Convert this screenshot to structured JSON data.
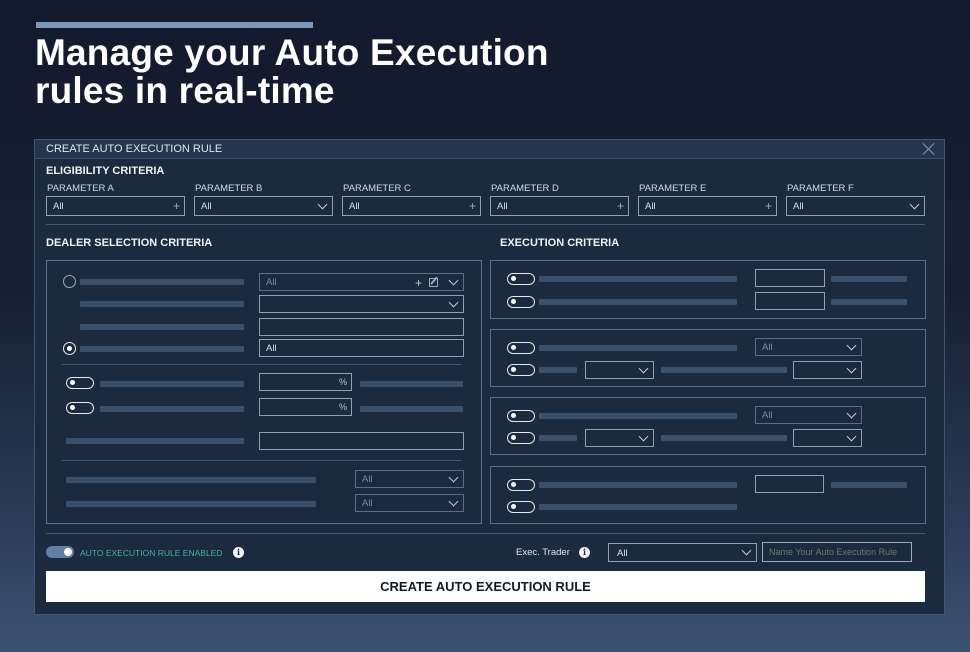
{
  "headline": {
    "line1": "Manage your Auto Execution",
    "line2": "rules in real-time"
  },
  "dialog": {
    "title": "CREATE AUTO EXECUTION RULE",
    "eligibility": {
      "title": "ELIGIBILITY CRITERIA",
      "params": [
        {
          "label": "PARAMETER A",
          "value": "All",
          "control": "plus"
        },
        {
          "label": "PARAMETER B",
          "value": "All",
          "control": "dropdown"
        },
        {
          "label": "PARAMETER C",
          "value": "All",
          "control": "plus"
        },
        {
          "label": "PARAMETER D",
          "value": "All",
          "control": "plus"
        },
        {
          "label": "PARAMETER E",
          "value": "All",
          "control": "plus"
        },
        {
          "label": "PARAMETER F",
          "value": "All",
          "control": "dropdown"
        }
      ]
    },
    "dealer": {
      "title": "DEALER SELECTION CRITERIA",
      "option1_value": "All",
      "option2_value": "All",
      "pct1": "%",
      "pct2": "%",
      "select1": "All",
      "select2": "All"
    },
    "execution": {
      "title": "EXECUTION CRITERIA",
      "select1": "All",
      "select2": "All"
    },
    "footer": {
      "enabled_label": "AUTO EXECUTION RULE ENABLED",
      "info_glyph": "i",
      "trader_label": "Exec. Trader",
      "trader_value": "All",
      "name_placeholder": "Name Your Auto Execution Rule",
      "create_label": "CREATE AUTO EXECUTION RULE"
    }
  }
}
